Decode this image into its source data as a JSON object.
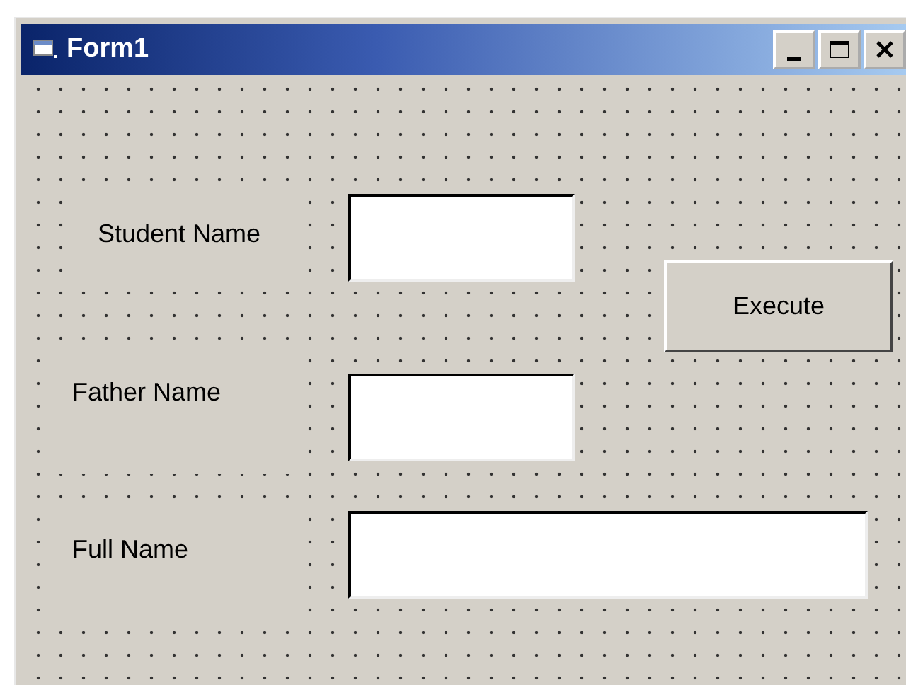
{
  "window": {
    "title": "Form1"
  },
  "labels": [
    {
      "text": "Student Name"
    },
    {
      "text": "Father Name"
    },
    {
      "text": "Full Name"
    }
  ],
  "text_boxes": [
    {
      "kind": "short"
    },
    {
      "kind": "short"
    },
    {
      "kind": "wide"
    }
  ],
  "buttons": [
    {
      "label": "Execute"
    }
  ]
}
